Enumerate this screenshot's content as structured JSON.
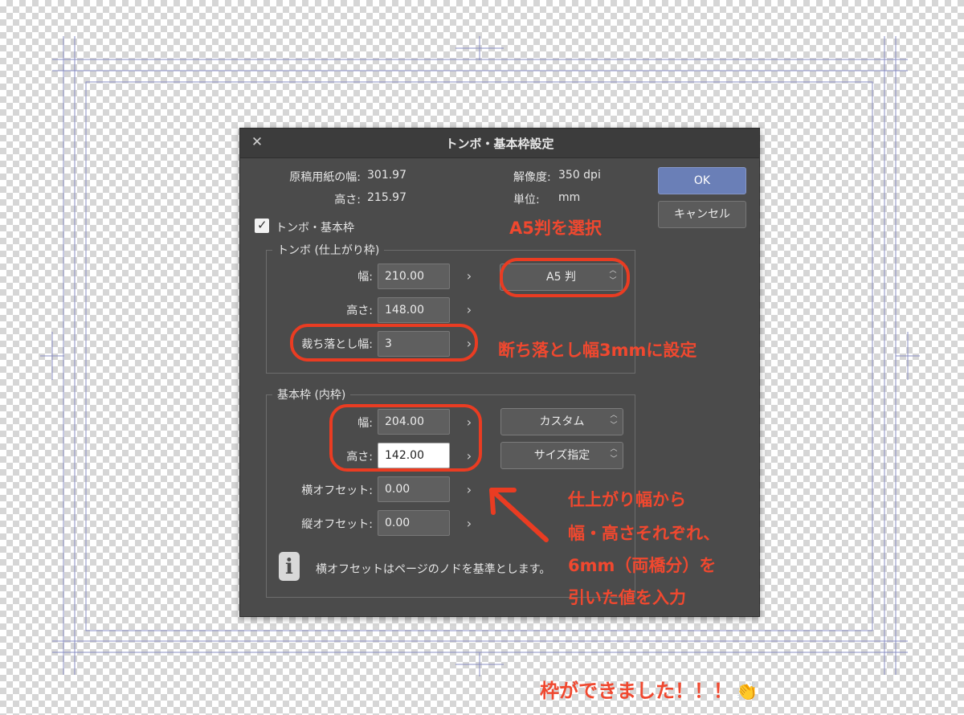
{
  "dialog": {
    "title": "トンボ・基本枠設定",
    "close_icon": "close-icon",
    "paper_width_label": "原稿用紙の幅:",
    "paper_width_value": "301.97",
    "paper_height_label": "高さ:",
    "paper_height_value": "215.97",
    "resolution_label": "解像度:",
    "resolution_value": "350 dpi",
    "unit_label": "単位:",
    "unit_value": "mm",
    "ok_label": "OK",
    "cancel_label": "キャンセル",
    "enable_checkbox_label": "トンボ・基本枠",
    "enable_checked": true,
    "trim_group": {
      "title": "トンボ (仕上がり枠)",
      "width_label": "幅:",
      "width_value": "210.00",
      "height_label": "高さ:",
      "height_value": "148.00",
      "bleed_label": "裁ち落とし幅:",
      "bleed_value": "3",
      "preset_value": "A5 判"
    },
    "basic_group": {
      "title": "基本枠 (内枠)",
      "width_label": "幅:",
      "width_value": "204.00",
      "height_label": "高さ:",
      "height_value": "142.00",
      "h_offset_label": "横オフセット:",
      "h_offset_value": "0.00",
      "v_offset_label": "縦オフセット:",
      "v_offset_value": "0.00",
      "preset_value": "カスタム",
      "size_mode_value": "サイズ指定"
    },
    "info_text": "横オフセットはページのノドを基準とします。"
  },
  "annotations": {
    "select_a5": "A5判を選択",
    "bleed_note": "断ち落とし幅3mmに設定",
    "inner_note_lines": [
      "仕上がり幅から",
      "幅・高さそれぞれ、",
      "6mm（両橋分）を",
      "引いた値を入力"
    ],
    "done_note": "枠ができました！！！",
    "clap_icon": "clapping-hands-icon"
  },
  "colors": {
    "annotation": "#f0482f",
    "guide_lines": "#8a8fc4",
    "dialog_bg": "#4b4b4b",
    "ok_button": "#6a7fb7"
  }
}
